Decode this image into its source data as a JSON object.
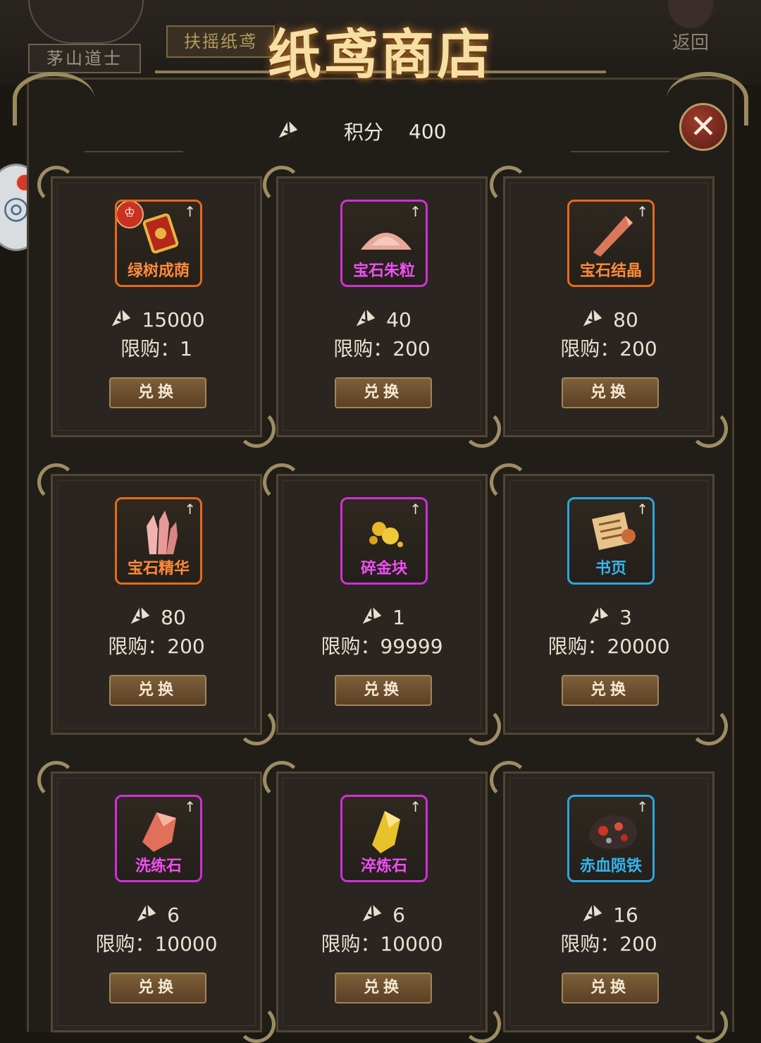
{
  "background": {
    "character_name": "茅山道士",
    "tab_label": "扶摇纸鸢",
    "back_label": "返回"
  },
  "header": {
    "title": "纸鸢商店",
    "points_label": "积分",
    "points_value": "400",
    "close_icon": "close-icon"
  },
  "items": [
    {
      "name": "绿树成荫",
      "price": "15000",
      "limit": "限购：1",
      "button": "兑换",
      "rarity": "orange",
      "icon": "token-icon",
      "badge": true
    },
    {
      "name": "宝石朱粒",
      "price": "40",
      "limit": "限购：200",
      "button": "兑换",
      "rarity": "purple",
      "icon": "sand-pile-icon"
    },
    {
      "name": "宝石结晶",
      "price": "80",
      "limit": "限购：200",
      "button": "兑换",
      "rarity": "orange",
      "icon": "crystal-shard-icon"
    },
    {
      "name": "宝石精华",
      "price": "80",
      "limit": "限购：200",
      "button": "兑换",
      "rarity": "orange",
      "icon": "crystal-cluster-icon"
    },
    {
      "name": "碎金块",
      "price": "1",
      "limit": "限购：99999",
      "button": "兑换",
      "rarity": "purple",
      "icon": "gold-nuggets-icon"
    },
    {
      "name": "书页",
      "price": "3",
      "limit": "限购：20000",
      "button": "兑换",
      "rarity": "blue",
      "icon": "scroll-icon"
    },
    {
      "name": "洗练石",
      "price": "6",
      "limit": "限购：10000",
      "button": "兑换",
      "rarity": "purple",
      "icon": "red-gem-icon"
    },
    {
      "name": "淬炼石",
      "price": "6",
      "limit": "限购：10000",
      "button": "兑换",
      "rarity": "purple",
      "icon": "yellow-gem-icon"
    },
    {
      "name": "赤血陨铁",
      "price": "16",
      "limit": "限购：200",
      "button": "兑换",
      "rarity": "blue",
      "icon": "meteor-ore-icon"
    }
  ],
  "colors": {
    "orange": "#e66a18",
    "purple": "#d22fd6",
    "blue": "#2aa7e0",
    "accent_gold": "#9e8d62"
  }
}
